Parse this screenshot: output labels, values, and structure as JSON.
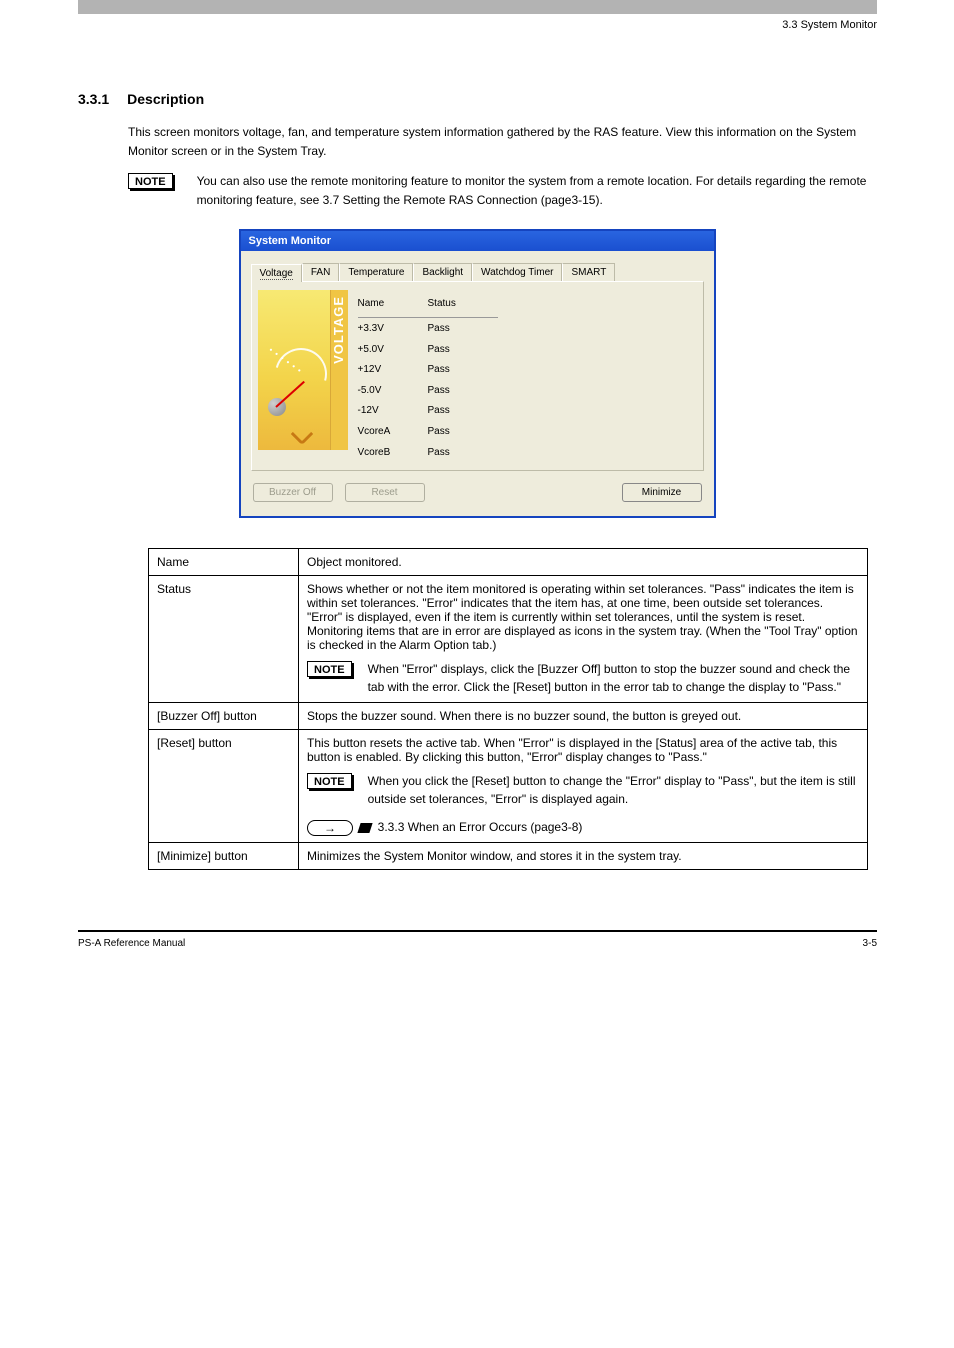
{
  "header": {
    "crumb": "3.3  System Monitor"
  },
  "section": {
    "number": "3.3.1",
    "title": "Description",
    "paragraph": "This screen monitors voltage, fan, and temperature system information gathered by the RAS feature. View this information on the System Monitor screen or in the System Tray.",
    "note_label": "NOTE",
    "note_text": "You can also use the remote monitoring feature to monitor the system from a remote location.  For details regarding the remote monitoring feature, see 3.7  Setting the Remote RAS Connection (page3-15)."
  },
  "window": {
    "title": "System Monitor",
    "tabs": [
      "Voltage",
      "FAN",
      "Temperature",
      "Backlight",
      "Watchdog Timer",
      "SMART"
    ],
    "active_tab": 0,
    "gauge_label": "VOLTAGE",
    "columns": {
      "name": "Name",
      "status": "Status"
    },
    "rows": [
      {
        "name": "+3.3V",
        "status": "Pass"
      },
      {
        "name": "+5.0V",
        "status": "Pass"
      },
      {
        "name": "+12V",
        "status": "Pass"
      },
      {
        "name": "-5.0V",
        "status": "Pass"
      },
      {
        "name": "-12V",
        "status": "Pass"
      },
      {
        "name": "VcoreA",
        "status": "Pass"
      },
      {
        "name": "VcoreB",
        "status": "Pass"
      }
    ],
    "buttons": {
      "buzzer": "Buzzer Off",
      "reset": "Reset",
      "minimize": "Minimize"
    }
  },
  "table": {
    "rows": [
      {
        "k": "Name",
        "v": "Object monitored."
      },
      {
        "k": "Status",
        "v": "Shows whether or not the item monitored is operating within set tolerances. \"Pass\" indicates the item is within set tolerances. \"Error\" indicates that the item has, at one time, been outside set tolerances. \"Error\" is displayed, even if the item is currently within set tolerances, until the system is reset. Monitoring items that are in error are displayed as icons in the system tray. (When the \"Tool Tray\" option is checked in the Alarm Option tab.)",
        "note": "NOTE",
        "note_body": "When \"Error\" displays, click the [Buzzer Off] button to stop the buzzer sound and check the tab with the error. Click the [Reset] button in the error tab to change the display to \"Pass.\""
      },
      {
        "k": "[Buzzer Off] button",
        "v": "Stops the buzzer sound. When there is no buzzer sound, the button is greyed out."
      },
      {
        "k": "[Reset] button",
        "v": "This button resets the active tab. When \"Error\" is displayed in the [Status] area of the active tab, this button is enabled. By clicking this button, \"Error\" display changes to \"Pass.\"",
        "note": "NOTE",
        "note_body": "When you click the [Reset] button to change the \"Error\" display to \"Pass\", but the item is still outside set tolerances, \"Error\" is displayed again.",
        "see_also": "3.3.3  When an Error Occurs (page3-8)"
      },
      {
        "k": "[Minimize] button",
        "v": "Minimizes the System Monitor window, and stores it in the system tray."
      }
    ]
  },
  "footer": {
    "left": "PS-A Reference Manual",
    "right": "3-5"
  }
}
